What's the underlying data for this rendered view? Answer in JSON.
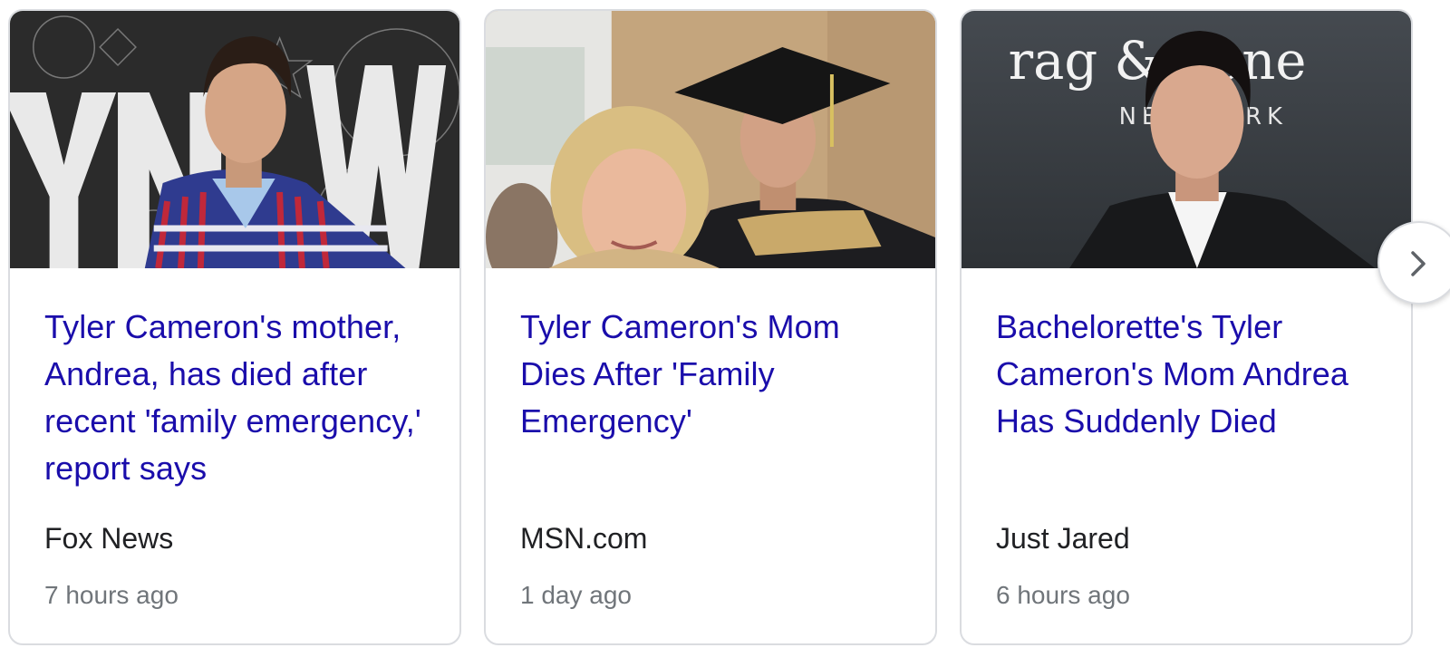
{
  "cards": [
    {
      "headline": "Tyler Cameron's mother, Andrea, has died after recent 'family emergency,' report says",
      "source": "Fox News",
      "time": "7 hours ago",
      "image_alt": "Tyler Cameron at event with mural backdrop"
    },
    {
      "headline": "Tyler Cameron's Mom Dies After 'Family Emergency'",
      "source": "MSN.com",
      "time": "1 day ago",
      "image_alt": "Tyler Cameron in graduation cap with his mother"
    },
    {
      "headline": "Bachelorette's Tyler Cameron's Mom Andrea Has Suddenly Died",
      "source": "Just Jared",
      "time": "6 hours ago",
      "image_alt": "Tyler Cameron at rag & bone event"
    }
  ],
  "backdrop_text": "rag & bone",
  "next_button_icon": "chevron-right-icon",
  "colors": {
    "headline": "#1a0dab",
    "source": "#202124",
    "time": "#70757a",
    "border": "#dadce0"
  }
}
